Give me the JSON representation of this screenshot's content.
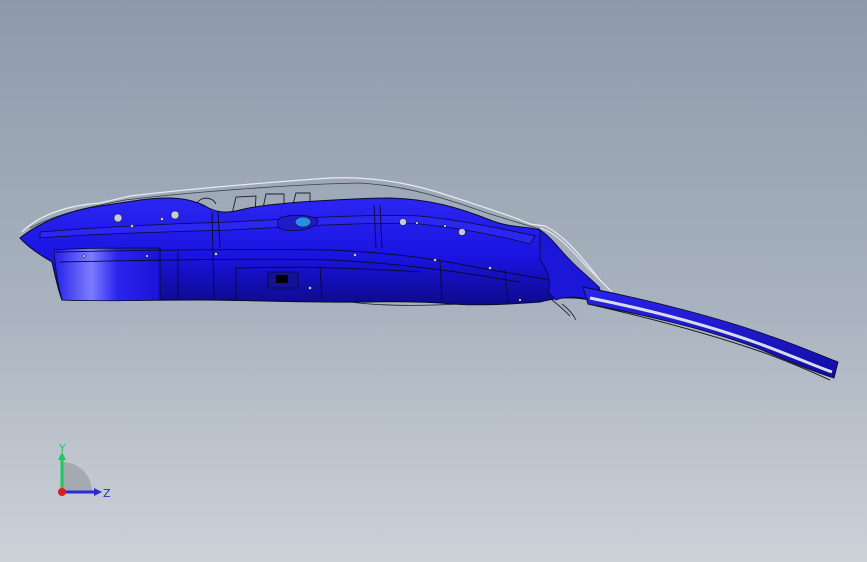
{
  "viewport": {
    "model": "sheet-metal-panel-assembly",
    "colors": {
      "background_top": "#8e9aab",
      "background_bottom": "#cdd2d8",
      "part_blue": "#1a14e0",
      "part_blue_dark": "#0d0a8a",
      "part_highlight": "#5a5cff",
      "edge_line": "#111111",
      "ghost_line": "#e8ecf2"
    }
  },
  "triad": {
    "y_label": "Y",
    "z_label": "Z",
    "y_color": "#22c55e",
    "z_color": "#2a2ad8",
    "x_color": "#e01b1b"
  }
}
